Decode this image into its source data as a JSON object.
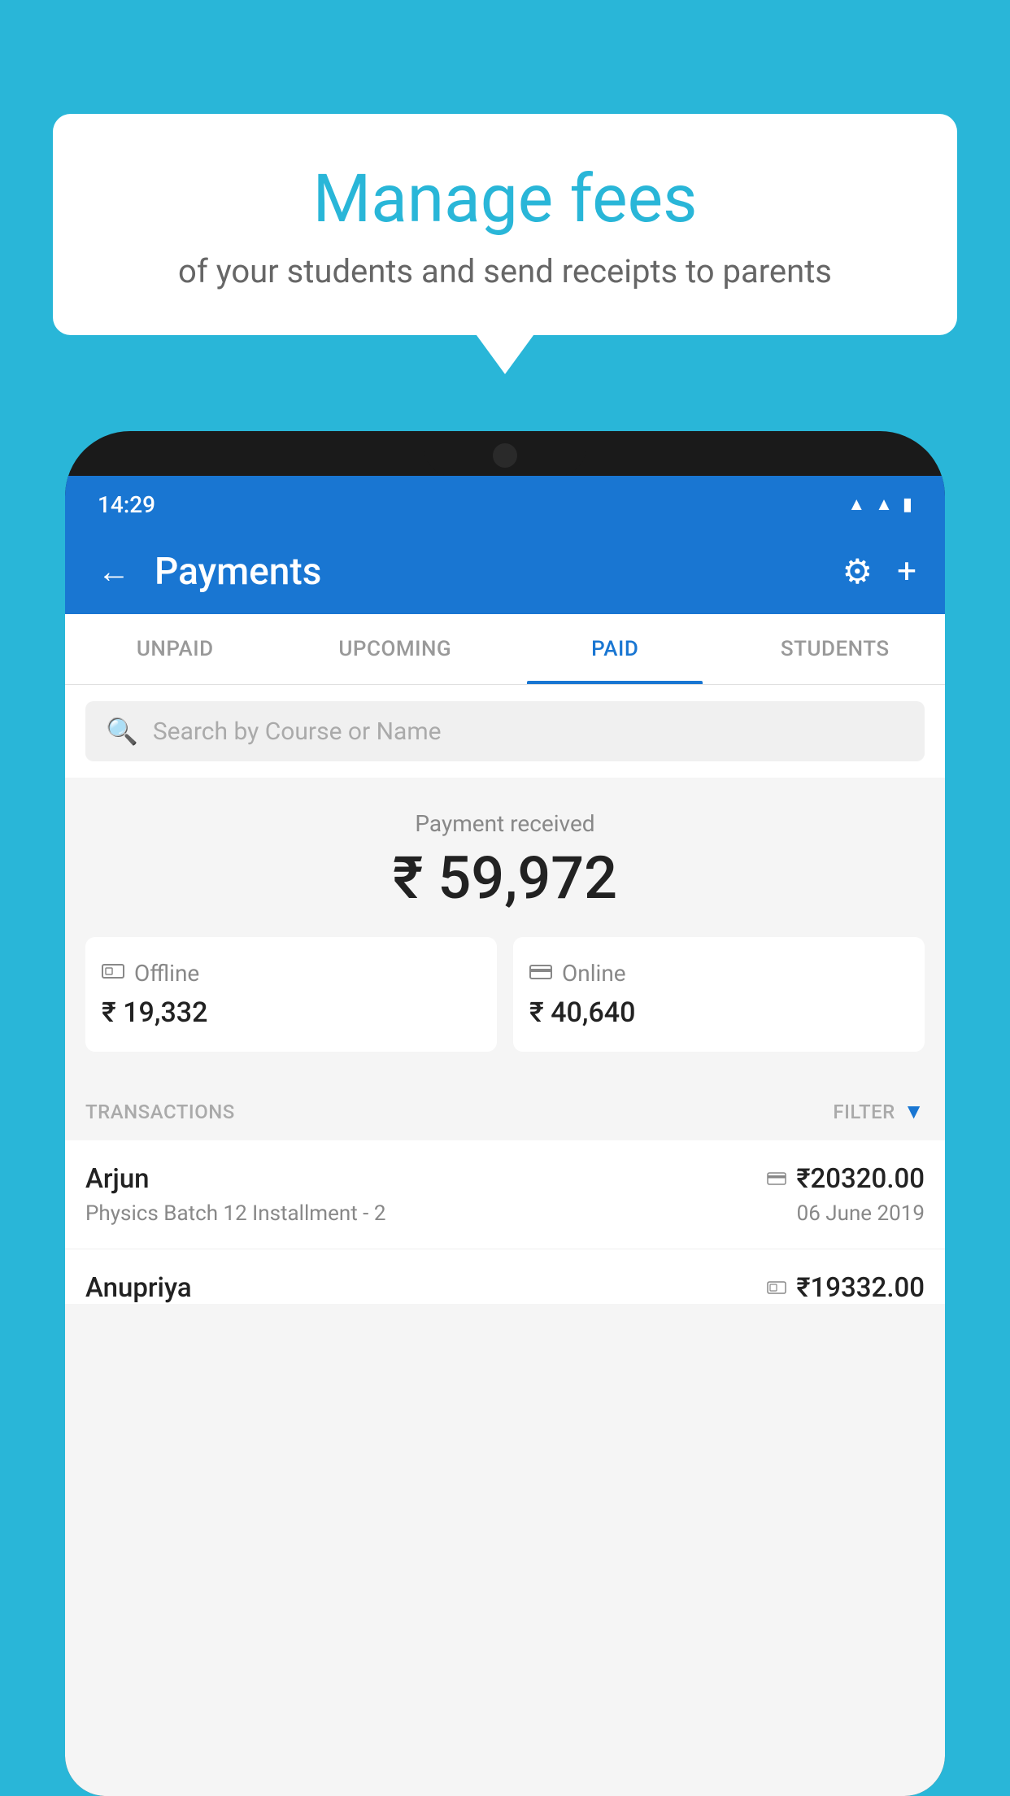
{
  "background_color": "#29b6d8",
  "speech_bubble": {
    "title": "Manage fees",
    "subtitle": "of your students and send receipts to parents"
  },
  "status_bar": {
    "time": "14:29",
    "icons": [
      "wifi",
      "signal",
      "battery"
    ]
  },
  "app_bar": {
    "title": "Payments",
    "back_label": "←",
    "gear_label": "⚙",
    "plus_label": "+"
  },
  "tabs": [
    {
      "label": "UNPAID",
      "active": false
    },
    {
      "label": "UPCOMING",
      "active": false
    },
    {
      "label": "PAID",
      "active": true
    },
    {
      "label": "STUDENTS",
      "active": false
    }
  ],
  "search": {
    "placeholder": "Search by Course or Name"
  },
  "payment_summary": {
    "received_label": "Payment received",
    "total_amount": "₹ 59,972",
    "offline_label": "Offline",
    "offline_amount": "₹ 19,332",
    "online_label": "Online",
    "online_amount": "₹ 40,640"
  },
  "transactions": {
    "header_label": "TRANSACTIONS",
    "filter_label": "FILTER",
    "items": [
      {
        "name": "Arjun",
        "amount": "₹20320.00",
        "course": "Physics Batch 12 Installment - 2",
        "date": "06 June 2019",
        "pay_type": "card"
      },
      {
        "name": "Anupriya",
        "amount": "₹19332.00",
        "course": "",
        "date": "",
        "pay_type": "cash"
      }
    ]
  }
}
